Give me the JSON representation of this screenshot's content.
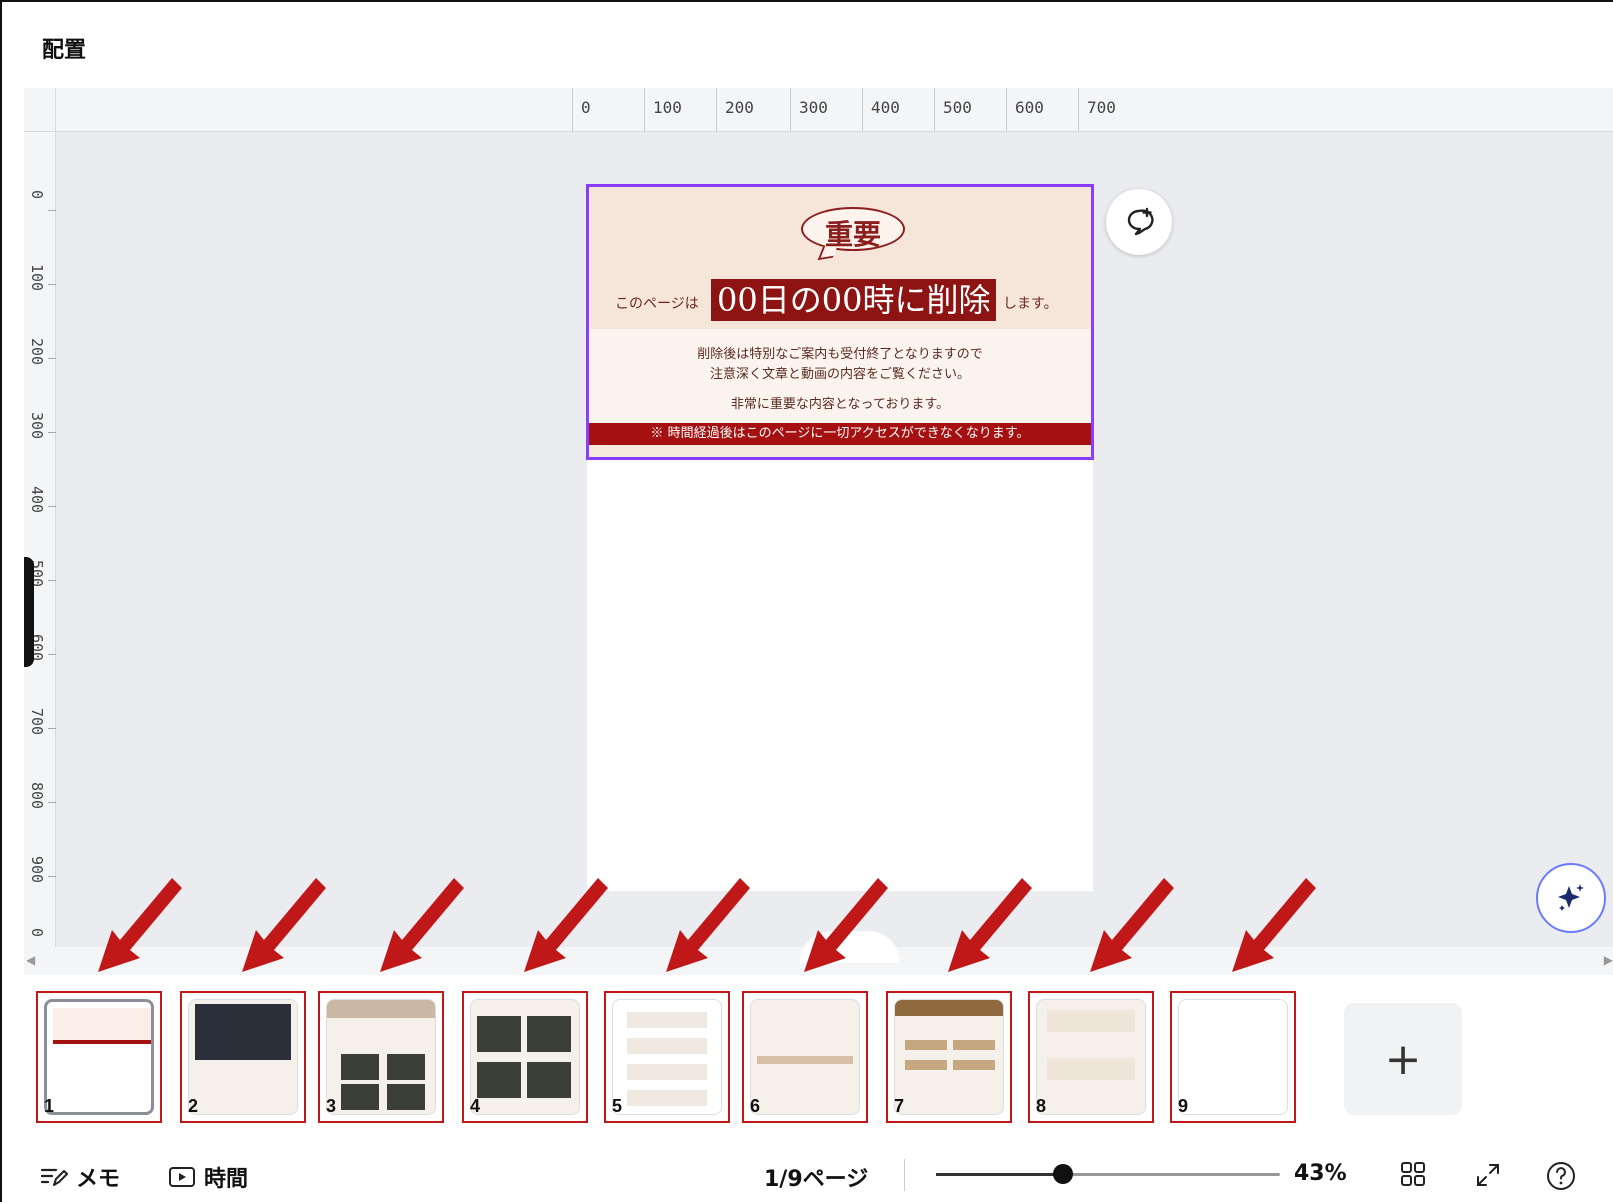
{
  "app": {
    "title": "配置"
  },
  "rulers": {
    "horizontal": [
      "0",
      "100",
      "200",
      "300",
      "400",
      "500",
      "600",
      "700"
    ],
    "vertical": [
      "0",
      "100",
      "200",
      "300",
      "400",
      "500",
      "600",
      "700",
      "800",
      "900",
      "0"
    ]
  },
  "page": {
    "bubble": "重要",
    "headline_pre": "このページは",
    "headline_main": "00日の00時に削除",
    "headline_post": "します。",
    "body_line1": "削除後は特別なご案内も受付終了となりますので",
    "body_line2": "注意深く文章と動画の内容をご覧ください。",
    "body_line3": "非常に重要な内容となっております。",
    "banner": "※ 時間経過後はこのページに一切アクセスができなくなります。"
  },
  "thumbnails": [
    {
      "num": "1",
      "active": true
    },
    {
      "num": "2"
    },
    {
      "num": "3"
    },
    {
      "num": "4"
    },
    {
      "num": "5"
    },
    {
      "num": "6"
    },
    {
      "num": "7"
    },
    {
      "num": "8"
    },
    {
      "num": "9"
    }
  ],
  "add_page_label": "+",
  "status": {
    "memo_label": "メモ",
    "time_label": "時間",
    "page_indicator": "1/9ページ",
    "zoom_label": "43%",
    "zoom_fraction": 0.37
  },
  "colors": {
    "accent": "#8b3dff",
    "annotation_red": "#c01818",
    "headline_bg": "#8e1313"
  },
  "icons": [
    "comment-add-icon",
    "magic-sparkle-icon",
    "memo-icon",
    "timer-icon",
    "grid-view-icon",
    "fullscreen-icon",
    "help-icon"
  ]
}
